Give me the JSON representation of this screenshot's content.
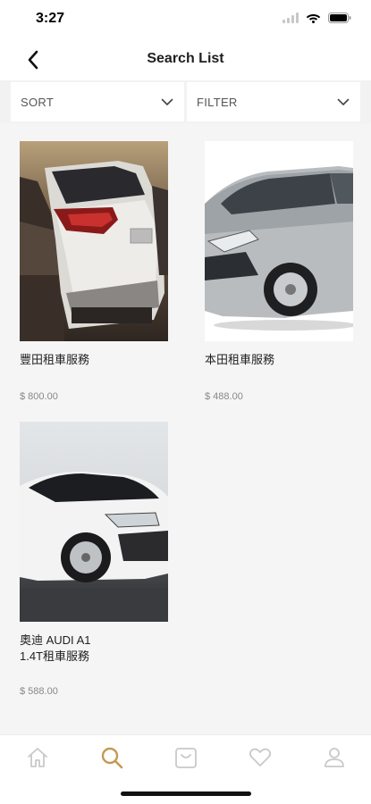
{
  "status_bar": {
    "time": "3:27"
  },
  "header": {
    "title": "Search List"
  },
  "toolbar": {
    "sort_label": "SORT",
    "filter_label": "FILTER"
  },
  "products": [
    {
      "name": "豐田租車服務",
      "price": "$ 800.00"
    },
    {
      "name": "本田租車服務",
      "price": "$ 488.00"
    },
    {
      "name": " 奧迪 AUDI A1\n1.4T租車服務",
      "price": "$ 588.00"
    }
  ],
  "bottom_nav": {
    "items": [
      "home-icon",
      "search-icon",
      "cart-icon",
      "heart-icon",
      "profile-icon"
    ],
    "active_index": 1,
    "active_color": "#c49a52",
    "inactive_color": "#c9c9c9"
  }
}
